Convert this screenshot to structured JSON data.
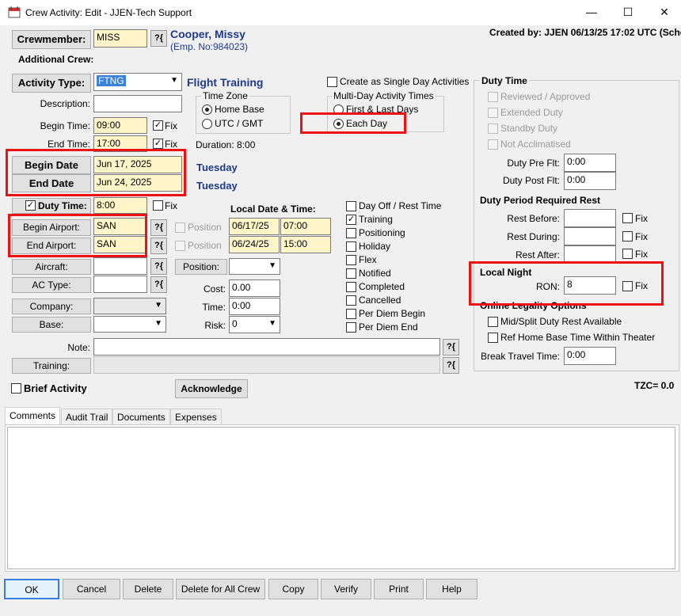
{
  "window": {
    "title": "Crew Activity:  Edit - JJEN-Tech Support",
    "minimize": "—",
    "maximize": "☐",
    "close": "✕"
  },
  "header": {
    "crewmember_label": "Crewmember:",
    "crewmember_code": "MISS",
    "crew_name": "Cooper, Missy",
    "emp_no": "(Emp. No:984023)",
    "additional_crew_label": "Additional Crew:",
    "created_by": "Created by:  JJEN 06/13/25 17:02 UTC (Schedu"
  },
  "activity": {
    "type_label": "Activity Type:",
    "type_value": "FTNG",
    "type_desc": "Flight Training",
    "description_label": "Description:",
    "description_value": "",
    "begin_time_label": "Begin Time:",
    "begin_time": "09:00",
    "end_time_label": "End Time:",
    "end_time": "17:00",
    "fix_label": "Fix",
    "begin_date_label": "Begin Date",
    "begin_date": "Jun 17, 2025",
    "begin_day": "Tuesday",
    "end_date_label": "End Date",
    "end_date": "Jun 24, 2025",
    "end_day": "Tuesday",
    "duty_time_label": "Duty Time:",
    "duty_time": "8:00",
    "duration": "Duration: 8:00"
  },
  "timezone": {
    "title": "Time Zone",
    "home_base": "Home Base",
    "utc": "UTC / GMT"
  },
  "multiday": {
    "single_day_label": "Create as Single Day Activities",
    "title": "Multi-Day Activity Times",
    "first_last": "First & Last Days",
    "each_day": "Each Day"
  },
  "airports": {
    "begin_label": "Begin Airport:",
    "begin_value": "SAN",
    "end_label": "End Airport:",
    "end_value": "SAN",
    "aircraft_label": "Aircraft:",
    "ac_type_label": "AC Type:",
    "company_label": "Company:",
    "base_label": "Base:"
  },
  "local_dt": {
    "title": "Local Date & Time:",
    "position_label": "Position",
    "begin_date": "06/17/25",
    "begin_time": "07:00",
    "end_date": "06/24/25",
    "end_time": "15:00",
    "position_btn": "Position:",
    "cost_label": "Cost:",
    "cost_value": "0.00",
    "time_label": "Time:",
    "time_value": "0:00",
    "risk_label": "Risk:",
    "risk_value": "0"
  },
  "flags": [
    {
      "label": "Day Off / Rest Time",
      "checked": false
    },
    {
      "label": "Training",
      "checked": true
    },
    {
      "label": "Positioning",
      "checked": false
    },
    {
      "label": "Holiday",
      "checked": false
    },
    {
      "label": "Flex",
      "checked": false
    },
    {
      "label": "Notified",
      "checked": false
    },
    {
      "label": "Completed",
      "checked": false
    },
    {
      "label": "Cancelled",
      "checked": false
    },
    {
      "label": "Per Diem Begin",
      "checked": false
    },
    {
      "label": "Per Diem End",
      "checked": false
    }
  ],
  "duty": {
    "title": "Duty Time",
    "reviewed": "Reviewed / Approved",
    "extended": "Extended Duty",
    "standby": "Standby Duty",
    "not_acclimatised": "Not Acclimatised",
    "pre_label": "Duty Pre Flt:",
    "pre_value": "0:00",
    "post_label": "Duty Post Flt:",
    "post_value": "0:00",
    "rest_title": "Duty Period Required Rest",
    "rest_before": "Rest Before:",
    "rest_during": "Rest During:",
    "rest_after": "Rest After:",
    "fix_label": "Fix",
    "local_night_title": "Local Night",
    "ron_label": "RON:",
    "ron_value": "8",
    "legality_title": "Online Legality Options",
    "mid_split": "Mid/Split Duty Rest Available",
    "ref_home": "Ref Home Base Time Within Theater",
    "break_label": "Break Travel Time:",
    "break_value": "0:00",
    "tzc": "TZC= 0.0"
  },
  "misc": {
    "note_label": "Note:",
    "training_label": "Training:",
    "brief_activity": "Brief Activity",
    "acknowledge": "Acknowledge",
    "q_icon": "?{"
  },
  "tabs": [
    "Comments",
    "Audit Trail",
    "Documents",
    "Expenses"
  ],
  "footer": [
    "OK",
    "Cancel",
    "Delete",
    "Delete for All Crew",
    "Copy",
    "Verify",
    "Print",
    "Help"
  ]
}
